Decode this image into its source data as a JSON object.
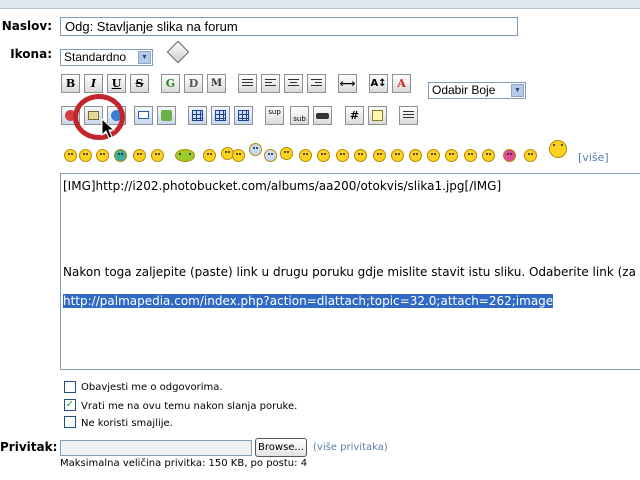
{
  "form": {
    "title_label": "Naslov:",
    "title_value": "Odg: Stavljanje slika na forum",
    "icon_label": "Ikona:",
    "icon_value": "Standardno",
    "color_select": "Odabir Boje",
    "more_smileys": "[više]"
  },
  "toolbar": {
    "row1": [
      "B",
      "I",
      "U",
      "S",
      "G",
      "D",
      "M",
      "align-left",
      "align-center",
      "align-right",
      "justify",
      "hr",
      "font-size",
      "font-color"
    ],
    "row2": [
      "flash",
      "image",
      "url",
      "email",
      "ftp",
      "table",
      "tr",
      "td",
      "sup",
      "sub",
      "tt",
      "code",
      "quote",
      "list"
    ]
  },
  "editor": {
    "line1": "[IMG]http://i202.photobucket.com/albums/aa200/otokvis/slika1.jpg[/IMG]",
    "line2": "Nakon toga zaljepite (paste) link u drugu poruku gdje mislite stavit istu sliku. Odaberite link (za",
    "line3": "http://palmapedia.com/index.php?action=dlattach;topic=32.0;attach=262;image"
  },
  "options": [
    {
      "label": "Obavjesti me o odgovorima.",
      "checked": false
    },
    {
      "label": "Vrati me na ovu temu nakon slanja poruke.",
      "checked": true
    },
    {
      "label": "Ne koristi smajlije.",
      "checked": false
    }
  ],
  "attachment": {
    "label": "Privitak:",
    "browse": "Browse...",
    "more": "(više privitaka)",
    "limit": "Maksimalna veličina privitka: 150 KB, po postu: 4"
  },
  "colors": {
    "accent": "#316ac5",
    "border": "#7f9db9",
    "highlight_circle": "#c0262c"
  }
}
